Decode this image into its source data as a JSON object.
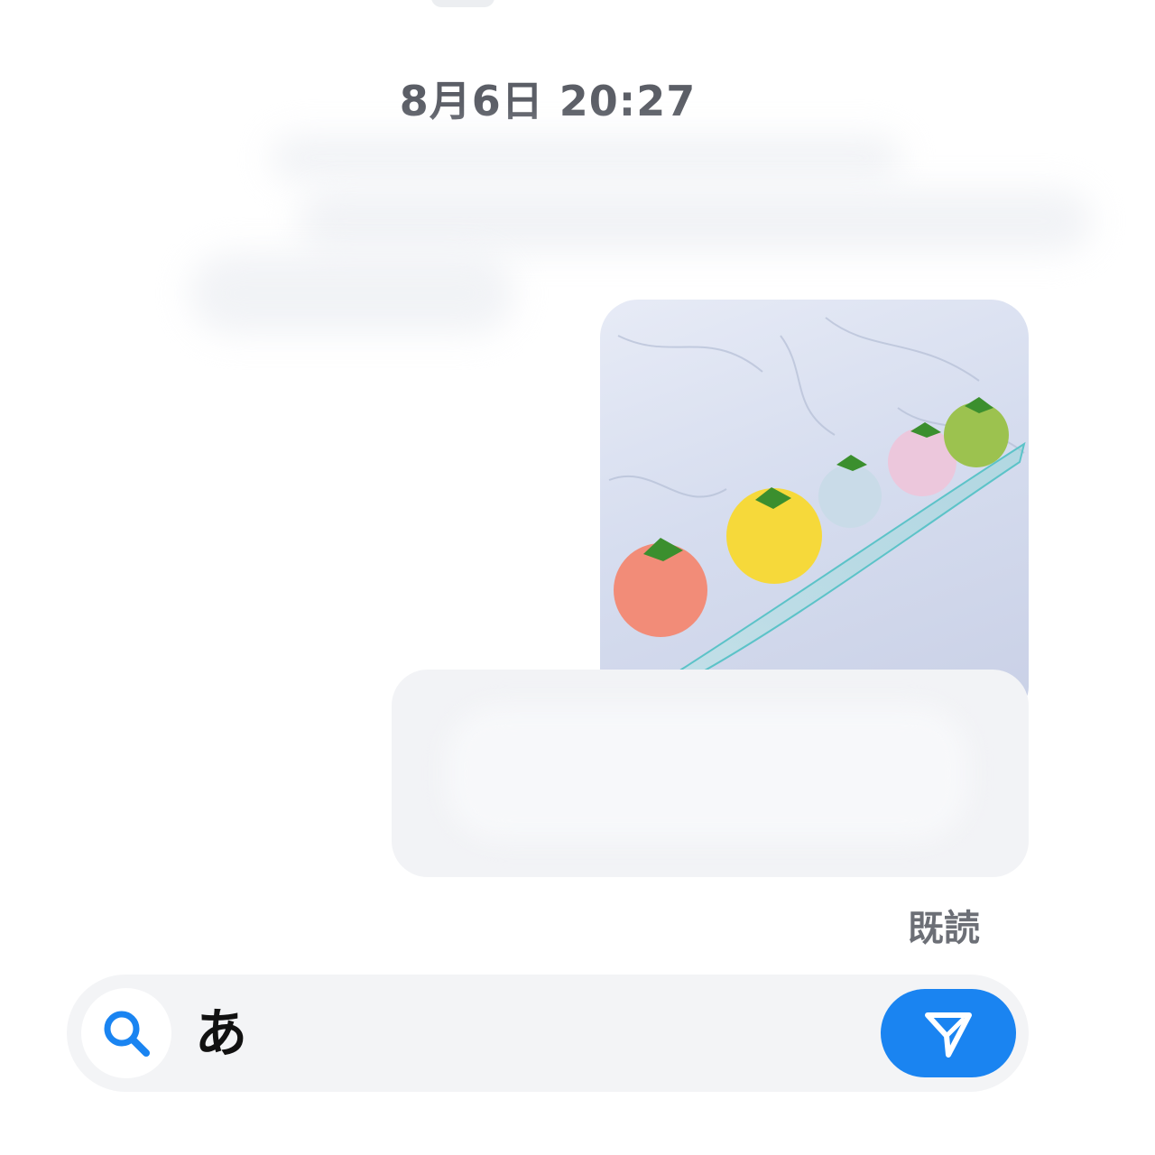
{
  "chat": {
    "timestamp": "8月6日 20:27",
    "read_receipt": "既読"
  },
  "composer": {
    "input_value": "あ",
    "search_icon": "search-icon",
    "send_icon": "send-icon"
  },
  "colors": {
    "accent": "#1a84f1",
    "timestamp_text": "#5b5e66",
    "bubble_bg": "#f2f3f6",
    "composer_bg": "#f3f4f6"
  },
  "photo": {
    "dessert_colors": [
      "#f28c78",
      "#f6d93a",
      "#c9dbe8",
      "#ecc7dc",
      "#9cc24f"
    ]
  }
}
